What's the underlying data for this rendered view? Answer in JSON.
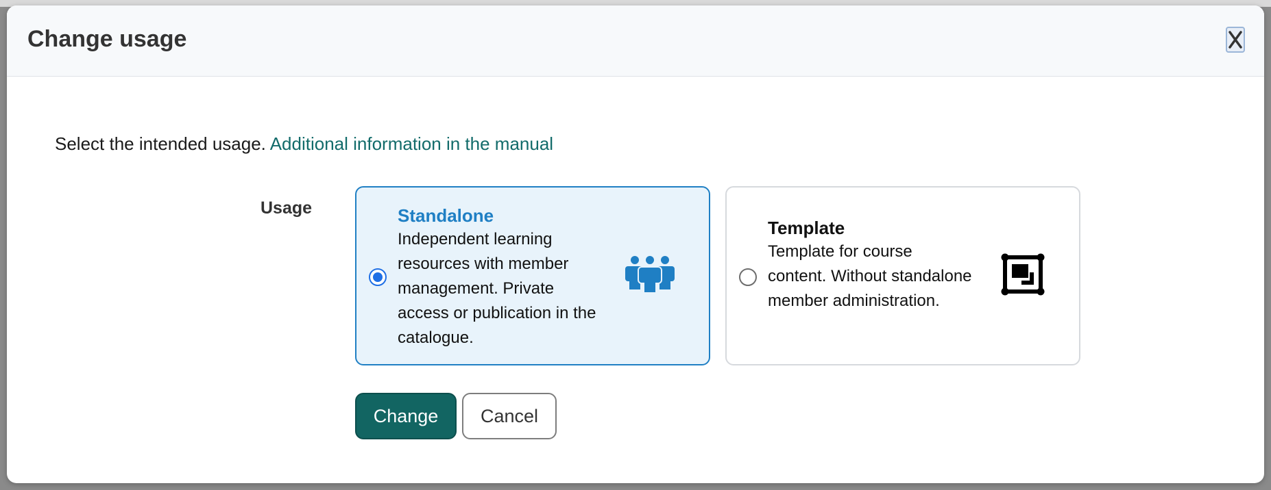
{
  "dialog": {
    "title": "Change usage",
    "close_icon": "close-icon"
  },
  "intro": {
    "text": "Select the intended usage.",
    "link": "Additional information in the manual"
  },
  "usage": {
    "label": "Usage",
    "selected": "standalone",
    "options": [
      {
        "id": "standalone",
        "title": "Standalone",
        "description": "Independent learning resources with member management. Private access or publication in the catalogue.",
        "icon": "group-of-people-icon"
      },
      {
        "id": "template",
        "title": "Template",
        "description": "Template for course content. Without standalone member administration.",
        "icon": "template-frame-icon"
      }
    ]
  },
  "buttons": {
    "change": "Change",
    "cancel": "Cancel"
  },
  "colors": {
    "accent": "#126562",
    "selected_border": "#1f7fc4",
    "selected_background": "#e8f3fb",
    "link": "#126b6a"
  }
}
